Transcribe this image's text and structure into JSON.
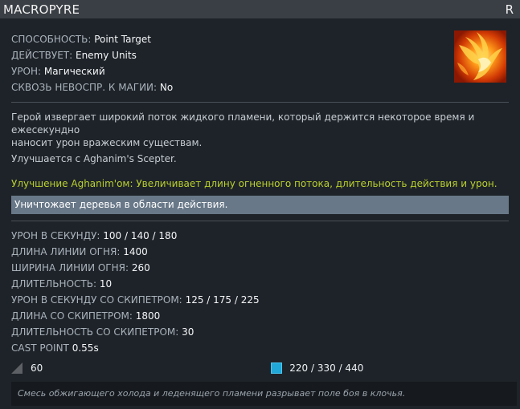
{
  "header": {
    "title": "MACROPYRE",
    "hotkey": "R"
  },
  "ability": {
    "rows": [
      {
        "label": "СПОСОБНОСТЬ:",
        "value": "Point Target"
      },
      {
        "label": "ДЕЙСТВУЕТ:",
        "value": "Enemy Units"
      },
      {
        "label": "УРОН:",
        "value": "Магический"
      },
      {
        "label": "СКВОЗЬ НЕВОСПР. К МАГИИ:",
        "value": "No"
      }
    ],
    "icon": "fire-phoenix-icon"
  },
  "description": {
    "line1": "Герой извергает широкий поток жидкого пламени, который держится некоторое время и ежесекундно",
    "line2": "наносит урон вражеским существам.",
    "upgrade_note": "Улучшается с Aghanim's Scepter.",
    "scepter_upgrade": "Улучшение Aghanim'ом: Увеличивает длину огненного потока, длительность действия и урон.",
    "highlight_note": "Уничтожает деревья в области действия."
  },
  "stats": [
    {
      "label": "УРОН В СЕКУНДУ:",
      "value": "100 / 140 / 180"
    },
    {
      "label": "ДЛИНА ЛИНИИ ОГНЯ:",
      "value": "1400"
    },
    {
      "label": "ШИРИНА ЛИНИИ ОГНЯ:",
      "value": "260"
    },
    {
      "label": "ДЛИТЕЛЬНОСТЬ:",
      "value": "10"
    },
    {
      "label": "УРОН В СЕКУНДУ СО СКИПЕТРОМ:",
      "value": "125 / 175 / 225"
    },
    {
      "label": "ДЛИНА СО СКИПЕТРОМ:",
      "value": "1800"
    },
    {
      "label": "ДЛИТЕЛЬНОСТЬ СО СКИПЕТРОМ:",
      "value": "30"
    },
    {
      "label": "CAST POINT",
      "value": "0.55s"
    }
  ],
  "costs": {
    "cooldown": "60",
    "mana": "220 / 330 / 440"
  },
  "lore": "Смесь обжигающего холода и леденящего пламени разрывает поле боя в клочья.",
  "colors": {
    "scepter": "#b9d02e",
    "mana": "#22a8d8",
    "highlight": "#687888"
  }
}
